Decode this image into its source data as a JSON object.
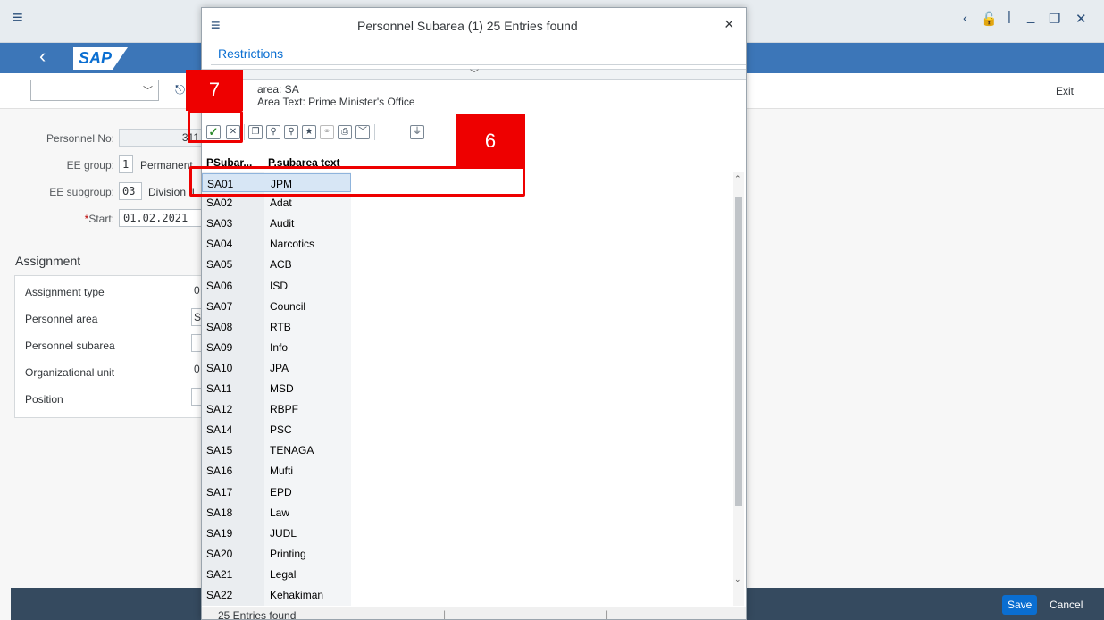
{
  "main": {
    "menu_icon": "menu-icon",
    "exit_label": "Exit",
    "labels": {
      "personnel_no": "Personnel No:",
      "ee_group": "EE group:",
      "ee_subgroup": "EE subgroup:",
      "start": "Start:",
      "start_required": "*"
    },
    "values": {
      "personnel_no": "311",
      "ee_group": "1",
      "ee_group_text": "Permanent",
      "ee_subgroup": "03",
      "ee_subgroup_text": "Division II",
      "start": "01.02.2021"
    },
    "assignment": {
      "title": "Assignment",
      "rows": [
        {
          "label": "Assignment type",
          "value": "0"
        },
        {
          "label": "Personnel area",
          "value": "S"
        },
        {
          "label": "Personnel subarea",
          "value": ""
        },
        {
          "label": "Organizational unit",
          "value": "0"
        },
        {
          "label": "Position",
          "value": ""
        }
      ]
    },
    "footer": {
      "save_label": "Save",
      "cancel_label": "Cancel"
    }
  },
  "dialog": {
    "title": "Personnel Subarea (1)  25 Entries found",
    "minimize_label": "_",
    "close_label": "×",
    "restrictions_tab": "Restrictions",
    "info_line1": "area: SA",
    "info_line2": "Area Text: Prime Minister's Office",
    "columns": [
      "PSubar...",
      "P.subarea text"
    ],
    "rows": [
      {
        "code": "SA01",
        "text": "JPM"
      },
      {
        "code": "SA02",
        "text": "Adat"
      },
      {
        "code": "SA03",
        "text": "Audit"
      },
      {
        "code": "SA04",
        "text": "Narcotics"
      },
      {
        "code": "SA05",
        "text": "ACB"
      },
      {
        "code": "SA06",
        "text": "ISD"
      },
      {
        "code": "SA07",
        "text": "Council"
      },
      {
        "code": "SA08",
        "text": "RTB"
      },
      {
        "code": "SA09",
        "text": "Info"
      },
      {
        "code": "SA10",
        "text": "JPA"
      },
      {
        "code": "SA11",
        "text": "MSD"
      },
      {
        "code": "SA12",
        "text": "RBPF"
      },
      {
        "code": "SA14",
        "text": "PSC"
      },
      {
        "code": "SA15",
        "text": "TENAGA"
      },
      {
        "code": "SA16",
        "text": "Mufti"
      },
      {
        "code": "SA17",
        "text": "EPD"
      },
      {
        "code": "SA18",
        "text": "Law"
      },
      {
        "code": "SA19",
        "text": "JUDL"
      },
      {
        "code": "SA20",
        "text": "Printing"
      },
      {
        "code": "SA21",
        "text": "Legal"
      },
      {
        "code": "SA22",
        "text": "Kehakiman"
      }
    ],
    "status_text": "25 Entries found"
  },
  "annotations": {
    "step7": "7",
    "step6": "6"
  },
  "accent_color": "#0a6ed1",
  "callout_color": "#ee0000"
}
